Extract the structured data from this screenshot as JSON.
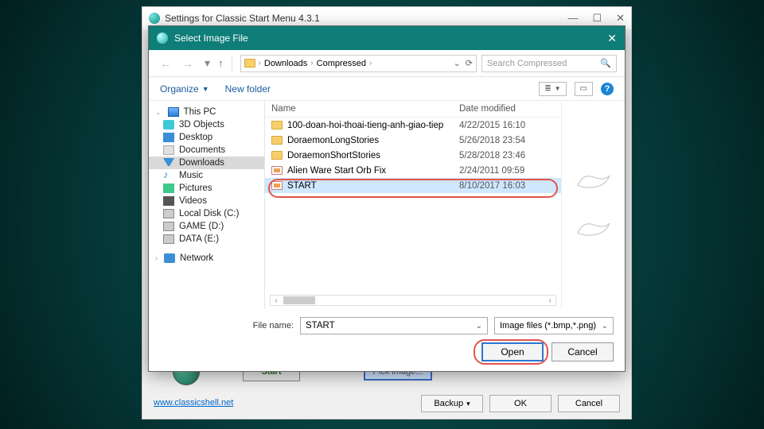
{
  "parent": {
    "title": "Settings for Classic Start Menu 4.3.1",
    "start_label": "Start",
    "pick_label": "Pick image...",
    "link": "www.classicshell.net",
    "backup": "Backup",
    "ok": "OK",
    "cancel": "Cancel"
  },
  "dialog": {
    "title": "Select Image File",
    "breadcrumb": {
      "a": "Downloads",
      "b": "Compressed"
    },
    "search_placeholder": "Search Compressed",
    "organize": "Organize",
    "newfolder": "New folder",
    "view_label": "≣",
    "cols": {
      "name": "Name",
      "date": "Date modified"
    },
    "tree": {
      "root": "This PC",
      "items": [
        "3D Objects",
        "Desktop",
        "Documents",
        "Downloads",
        "Music",
        "Pictures",
        "Videos",
        "Local Disk (C:)",
        "GAME (D:)",
        "DATA (E:)"
      ],
      "network": "Network"
    },
    "files": [
      {
        "name": "100-doan-hoi-thoai-tieng-anh-giao-tiep",
        "date": "4/22/2015 16:10",
        "type": "folder"
      },
      {
        "name": "DoraemonLongStories",
        "date": "5/26/2018 23:54",
        "type": "folder"
      },
      {
        "name": "DoraemonShortStories",
        "date": "5/28/2018 23:46",
        "type": "folder"
      },
      {
        "name": "Alien Ware Start Orb Fix",
        "date": "2/24/2011 09:59",
        "type": "img"
      },
      {
        "name": "START",
        "date": "8/10/2017 16:03",
        "type": "img",
        "selected": true
      }
    ],
    "footer": {
      "label": "File name:",
      "value": "START",
      "filter": "Image files (*.bmp,*.png)",
      "open": "Open",
      "cancel": "Cancel"
    }
  }
}
